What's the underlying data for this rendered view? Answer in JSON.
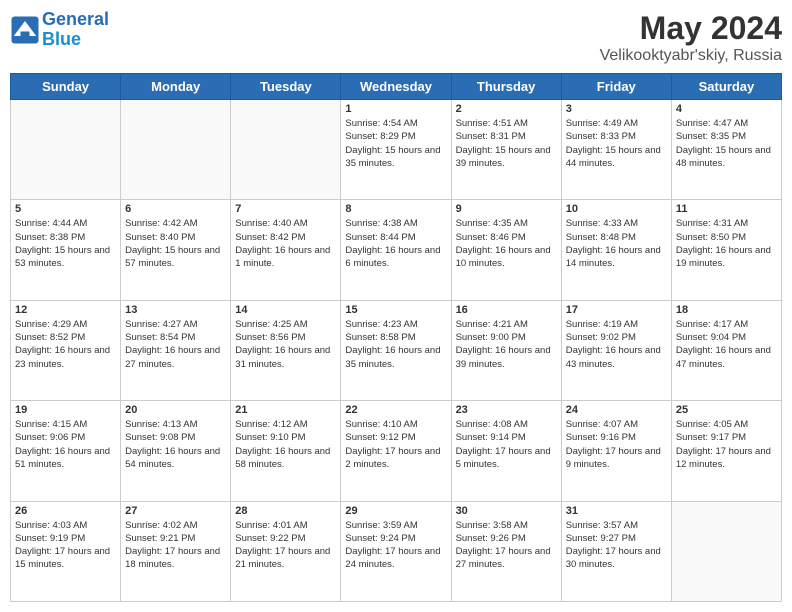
{
  "header": {
    "logo_line1": "General",
    "logo_line2": "Blue",
    "main_title": "May 2024",
    "sub_title": "Velikooktyabr'skiy, Russia"
  },
  "days_of_week": [
    "Sunday",
    "Monday",
    "Tuesday",
    "Wednesday",
    "Thursday",
    "Friday",
    "Saturday"
  ],
  "weeks": [
    [
      {
        "day": "",
        "info": ""
      },
      {
        "day": "",
        "info": ""
      },
      {
        "day": "",
        "info": ""
      },
      {
        "day": "1",
        "info": "Sunrise: 4:54 AM\nSunset: 8:29 PM\nDaylight: 15 hours and 35 minutes."
      },
      {
        "day": "2",
        "info": "Sunrise: 4:51 AM\nSunset: 8:31 PM\nDaylight: 15 hours and 39 minutes."
      },
      {
        "day": "3",
        "info": "Sunrise: 4:49 AM\nSunset: 8:33 PM\nDaylight: 15 hours and 44 minutes."
      },
      {
        "day": "4",
        "info": "Sunrise: 4:47 AM\nSunset: 8:35 PM\nDaylight: 15 hours and 48 minutes."
      }
    ],
    [
      {
        "day": "5",
        "info": "Sunrise: 4:44 AM\nSunset: 8:38 PM\nDaylight: 15 hours and 53 minutes."
      },
      {
        "day": "6",
        "info": "Sunrise: 4:42 AM\nSunset: 8:40 PM\nDaylight: 15 hours and 57 minutes."
      },
      {
        "day": "7",
        "info": "Sunrise: 4:40 AM\nSunset: 8:42 PM\nDaylight: 16 hours and 1 minute."
      },
      {
        "day": "8",
        "info": "Sunrise: 4:38 AM\nSunset: 8:44 PM\nDaylight: 16 hours and 6 minutes."
      },
      {
        "day": "9",
        "info": "Sunrise: 4:35 AM\nSunset: 8:46 PM\nDaylight: 16 hours and 10 minutes."
      },
      {
        "day": "10",
        "info": "Sunrise: 4:33 AM\nSunset: 8:48 PM\nDaylight: 16 hours and 14 minutes."
      },
      {
        "day": "11",
        "info": "Sunrise: 4:31 AM\nSunset: 8:50 PM\nDaylight: 16 hours and 19 minutes."
      }
    ],
    [
      {
        "day": "12",
        "info": "Sunrise: 4:29 AM\nSunset: 8:52 PM\nDaylight: 16 hours and 23 minutes."
      },
      {
        "day": "13",
        "info": "Sunrise: 4:27 AM\nSunset: 8:54 PM\nDaylight: 16 hours and 27 minutes."
      },
      {
        "day": "14",
        "info": "Sunrise: 4:25 AM\nSunset: 8:56 PM\nDaylight: 16 hours and 31 minutes."
      },
      {
        "day": "15",
        "info": "Sunrise: 4:23 AM\nSunset: 8:58 PM\nDaylight: 16 hours and 35 minutes."
      },
      {
        "day": "16",
        "info": "Sunrise: 4:21 AM\nSunset: 9:00 PM\nDaylight: 16 hours and 39 minutes."
      },
      {
        "day": "17",
        "info": "Sunrise: 4:19 AM\nSunset: 9:02 PM\nDaylight: 16 hours and 43 minutes."
      },
      {
        "day": "18",
        "info": "Sunrise: 4:17 AM\nSunset: 9:04 PM\nDaylight: 16 hours and 47 minutes."
      }
    ],
    [
      {
        "day": "19",
        "info": "Sunrise: 4:15 AM\nSunset: 9:06 PM\nDaylight: 16 hours and 51 minutes."
      },
      {
        "day": "20",
        "info": "Sunrise: 4:13 AM\nSunset: 9:08 PM\nDaylight: 16 hours and 54 minutes."
      },
      {
        "day": "21",
        "info": "Sunrise: 4:12 AM\nSunset: 9:10 PM\nDaylight: 16 hours and 58 minutes."
      },
      {
        "day": "22",
        "info": "Sunrise: 4:10 AM\nSunset: 9:12 PM\nDaylight: 17 hours and 2 minutes."
      },
      {
        "day": "23",
        "info": "Sunrise: 4:08 AM\nSunset: 9:14 PM\nDaylight: 17 hours and 5 minutes."
      },
      {
        "day": "24",
        "info": "Sunrise: 4:07 AM\nSunset: 9:16 PM\nDaylight: 17 hours and 9 minutes."
      },
      {
        "day": "25",
        "info": "Sunrise: 4:05 AM\nSunset: 9:17 PM\nDaylight: 17 hours and 12 minutes."
      }
    ],
    [
      {
        "day": "26",
        "info": "Sunrise: 4:03 AM\nSunset: 9:19 PM\nDaylight: 17 hours and 15 minutes."
      },
      {
        "day": "27",
        "info": "Sunrise: 4:02 AM\nSunset: 9:21 PM\nDaylight: 17 hours and 18 minutes."
      },
      {
        "day": "28",
        "info": "Sunrise: 4:01 AM\nSunset: 9:22 PM\nDaylight: 17 hours and 21 minutes."
      },
      {
        "day": "29",
        "info": "Sunrise: 3:59 AM\nSunset: 9:24 PM\nDaylight: 17 hours and 24 minutes."
      },
      {
        "day": "30",
        "info": "Sunrise: 3:58 AM\nSunset: 9:26 PM\nDaylight: 17 hours and 27 minutes."
      },
      {
        "day": "31",
        "info": "Sunrise: 3:57 AM\nSunset: 9:27 PM\nDaylight: 17 hours and 30 minutes."
      },
      {
        "day": "",
        "info": ""
      }
    ]
  ]
}
